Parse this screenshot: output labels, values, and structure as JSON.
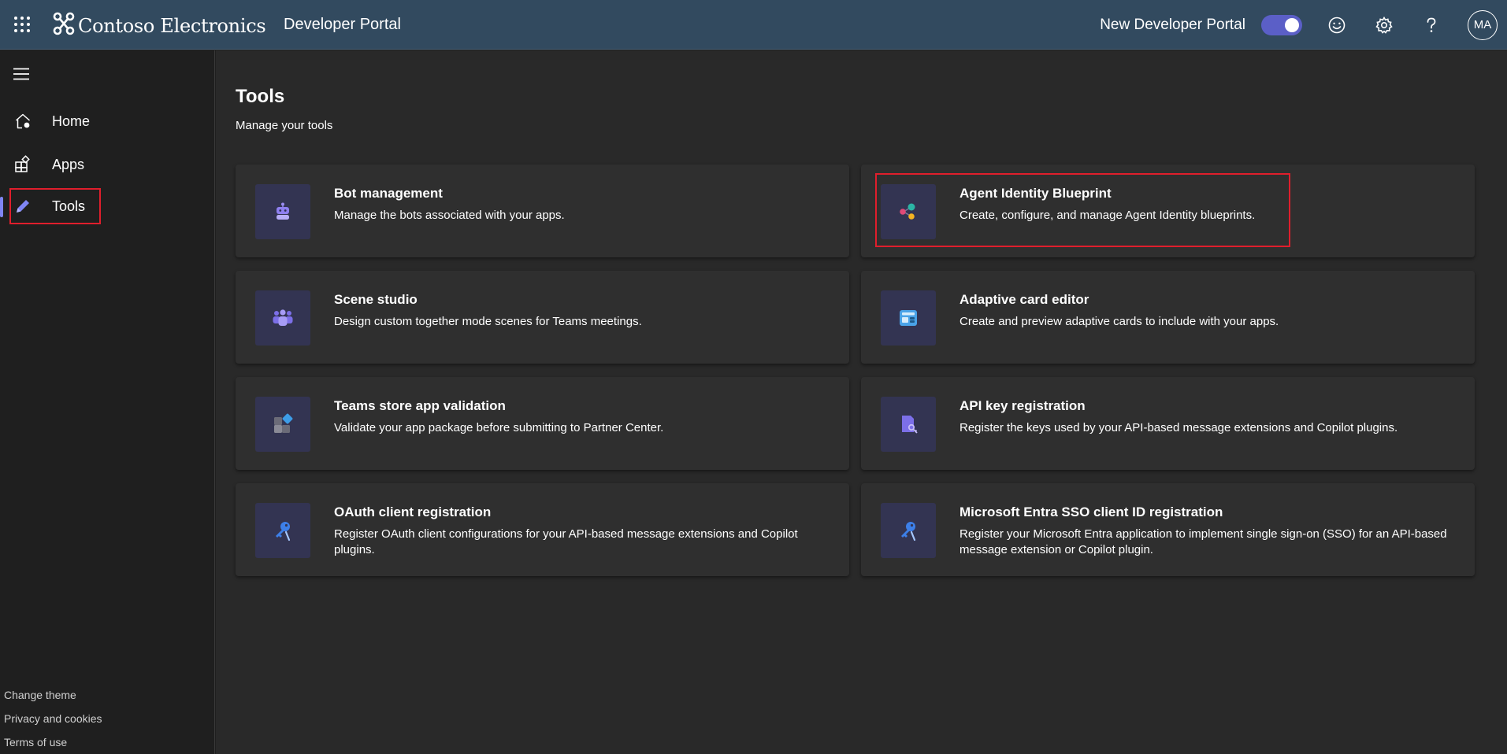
{
  "header": {
    "brand": "Contoso Electronics",
    "portal_title": "Developer Portal",
    "toggle_label": "New Developer Portal",
    "toggle_on": true,
    "avatar_initials": "MA",
    "icons": [
      "waffle-icon",
      "contoso-logo-icon",
      "smiley-feedback-icon",
      "gear-icon",
      "help-icon"
    ]
  },
  "sidebar": {
    "items": [
      {
        "label": "Home",
        "icon": "home-icon",
        "active": false
      },
      {
        "label": "Apps",
        "icon": "apps-icon",
        "active": false
      },
      {
        "label": "Tools",
        "icon": "pencil-icon",
        "active": true
      }
    ],
    "footer": [
      "Change theme",
      "Privacy and cookies",
      "Terms of use"
    ]
  },
  "main": {
    "title": "Tools",
    "subtitle": "Manage your tools",
    "cards": [
      {
        "title": "Bot management",
        "desc": "Manage the bots associated with your apps.",
        "icon": "bot-icon"
      },
      {
        "title": "Agent Identity Blueprint",
        "desc": "Create, configure, and manage Agent Identity blueprints.",
        "icon": "agent-identity-icon"
      },
      {
        "title": "Scene studio",
        "desc": "Design custom together mode scenes for Teams meetings.",
        "icon": "people-icon"
      },
      {
        "title": "Adaptive card editor",
        "desc": "Create and preview adaptive cards to include with your apps.",
        "icon": "adaptive-card-icon"
      },
      {
        "title": "Teams store app validation",
        "desc": "Validate your app package before submitting to Partner Center.",
        "icon": "app-validation-icon"
      },
      {
        "title": "API key registration",
        "desc": "Register the keys used by your API-based message extensions and Copilot plugins.",
        "icon": "api-key-icon"
      },
      {
        "title": "OAuth client registration",
        "desc": "Register OAuth client configurations for your API-based message extensions and Copilot plugins.",
        "icon": "key-icon"
      },
      {
        "title": "Microsoft Entra SSO client ID registration",
        "desc": "Register your Microsoft Entra application to implement single sign-on (SSO) for an API-based message extension or Copilot plugin.",
        "icon": "key-icon"
      }
    ]
  },
  "colors": {
    "header_bg": "#324a5f",
    "sidebar_bg": "#1f1f1f",
    "main_bg": "#292929",
    "card_bg": "#2f2f2f",
    "accent": "#5b5fc7",
    "highlight": "#e01e2c"
  }
}
